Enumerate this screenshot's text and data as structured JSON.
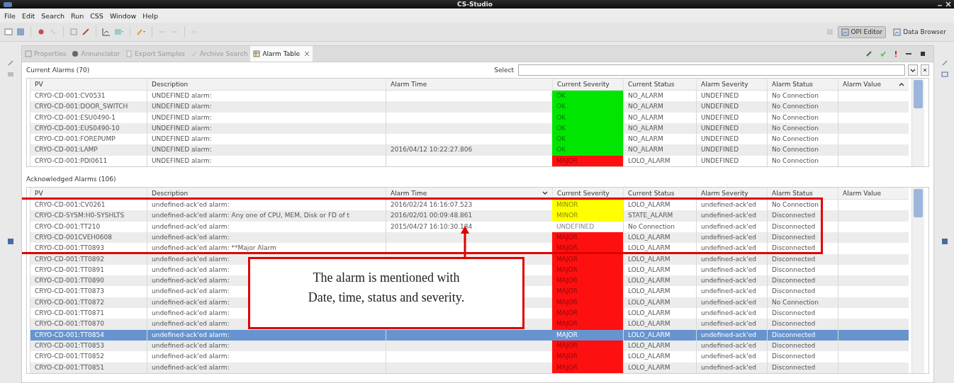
{
  "window": {
    "title": "CS-Studio"
  },
  "menu": [
    "File",
    "Edit",
    "Search",
    "Run",
    "CSS",
    "Window",
    "Help"
  ],
  "perspectives": [
    {
      "label": "OPI Editor",
      "selected": true
    },
    {
      "label": "Data Browser",
      "selected": false
    }
  ],
  "tabs": [
    {
      "label": "Properties",
      "kind": "properties",
      "selected": false
    },
    {
      "label": "Annunciator",
      "kind": "annunciator",
      "selected": false
    },
    {
      "label": "Export Samples",
      "kind": "export",
      "selected": false
    },
    {
      "label": "Archive Search",
      "kind": "archive",
      "selected": false
    },
    {
      "label": "Alarm Table",
      "kind": "table",
      "selected": true
    }
  ],
  "select": {
    "label": "Select"
  },
  "current": {
    "title": "Current Alarms (70)",
    "columns": [
      {
        "label": "PV",
        "sorted": false
      },
      {
        "label": "Description",
        "sorted": false
      },
      {
        "label": "Alarm Time",
        "sorted": false
      },
      {
        "label": "Current Severity",
        "sorted": false
      },
      {
        "label": "Current Status",
        "sorted": false
      },
      {
        "label": "Alarm Severity",
        "sorted": false
      },
      {
        "label": "Alarm Status",
        "sorted": false
      },
      {
        "label": "Alarm Value",
        "sorted": true,
        "descending": false
      }
    ],
    "rows": [
      {
        "pv": "CRYO-CD-001:CV0531",
        "description": "UNDEFINED alarm:",
        "severity": "OK",
        "color": "#00e600",
        "status": "NO_ALARM",
        "alarm_severity": "UNDEFINED",
        "alarm_status": "No Connection",
        "selected": false
      },
      {
        "pv": "CRYO-CD-001:DOOR_SWITCH",
        "description": "UNDEFINED alarm:",
        "severity": "OK",
        "color": "#00e600",
        "status": "NO_ALARM",
        "alarm_severity": "UNDEFINED",
        "alarm_status": "No Connection",
        "selected": false
      },
      {
        "pv": "CRYO-CD-001:ESU0490-1",
        "description": "UNDEFINED alarm:",
        "severity": "OK",
        "color": "#00e600",
        "status": "NO_ALARM",
        "alarm_severity": "UNDEFINED",
        "alarm_status": "No Connection",
        "selected": false
      },
      {
        "pv": "CRYO-CD-001:EUS0490-10",
        "description": "UNDEFINED alarm:",
        "severity": "OK",
        "color": "#00e600",
        "status": "NO_ALARM",
        "alarm_severity": "UNDEFINED",
        "alarm_status": "No Connection",
        "selected": false
      },
      {
        "pv": "CRYO-CD-001:FOREPUMP",
        "description": "UNDEFINED alarm:",
        "severity": "OK",
        "color": "#00e600",
        "status": "NO_ALARM",
        "alarm_severity": "UNDEFINED",
        "alarm_status": "No Connection",
        "selected": false
      },
      {
        "pv": "CRYO-CD-001:LAMP",
        "description": "UNDEFINED alarm:",
        "alarm_time": "2016/04/12 10:22:27.806",
        "severity": "OK",
        "color": "#00e600",
        "status": "NO_ALARM",
        "alarm_severity": "UNDEFINED",
        "alarm_status": "No Connection",
        "selected": false
      },
      {
        "pv": "CRYO-CD-001:PDI0611",
        "description": "UNDEFINED alarm:",
        "severity": "MAJOR",
        "color": "#ff1010",
        "status": "LOLO_ALARM",
        "alarm_severity": "UNDEFINED",
        "alarm_status": "No Connection",
        "selected": false
      }
    ]
  },
  "acknowledged": {
    "title": "Acknowledged Alarms (106)",
    "columns": [
      {
        "label": "PV",
        "sorted": false
      },
      {
        "label": "Description",
        "sorted": false
      },
      {
        "label": "Alarm Time",
        "sorted": true,
        "descending": true
      },
      {
        "label": "Current Severity",
        "sorted": false
      },
      {
        "label": "Current Status",
        "sorted": false
      },
      {
        "label": "Alarm Severity",
        "sorted": false
      },
      {
        "label": "Alarm Status",
        "sorted": false
      },
      {
        "label": "Alarm Value",
        "sorted": false
      }
    ],
    "rows": [
      {
        "pv": "CRYO-CD-001:CV0261",
        "description": "undefined-ack'ed alarm:",
        "alarm_time": "2016/02/24 16:16:07.523",
        "severity": "MINOR",
        "color": "#ffff00",
        "status": "LOLO_ALARM",
        "alarm_severity": "undefined-ack'ed",
        "alarm_status": "No Connection",
        "selected": false
      },
      {
        "pv": "CRYO-CD-SYSM:H0-SYSHLTS",
        "description": "undefined-ack'ed alarm: Any one of CPU, MEM, Disk or FD of t",
        "alarm_time": "2016/02/01 00:09:48.861",
        "severity": "MINOR",
        "color": "#ffff00",
        "status": "STATE_ALARM",
        "alarm_severity": "undefined-ack'ed",
        "alarm_status": "Disconnected",
        "selected": false
      },
      {
        "pv": "CRYO-CD-001:TT210",
        "description": "undefined-ack'ed alarm:",
        "alarm_time": "2015/04/27 16:10:30.184",
        "severity": "UNDEFINED",
        "color": "#ffffff",
        "status": "No Connection",
        "alarm_severity": "undefined-ack'ed",
        "alarm_status": "Disconnected",
        "selected": false
      },
      {
        "pv": "CRYO-CD-001CVEH0608",
        "description": "undefined-ack'ed alarm:",
        "severity": "MAJOR",
        "color": "#ff1010",
        "status": "LOLO_ALARM",
        "alarm_severity": "undefined-ack'ed",
        "alarm_status": "Disconnected",
        "selected": false
      },
      {
        "pv": "CRYO-CD-001:TT0893",
        "description": "undefined-ack'ed alarm: **Major Alarm",
        "severity": "MAJOR",
        "color": "#ff1010",
        "status": "LOLO_ALARM",
        "alarm_severity": "undefined-ack'ed",
        "alarm_status": "Disconnected",
        "selected": false
      },
      {
        "pv": "CRYO-CD-001:TT0892",
        "description": "undefined-ack'ed alarm:",
        "severity": "MAJOR",
        "color": "#ff1010",
        "status": "LOLO_ALARM",
        "alarm_severity": "undefined-ack'ed",
        "alarm_status": "Disconnected",
        "selected": false
      },
      {
        "pv": "CRYO-CD-001:TT0891",
        "description": "undefined-ack'ed alarm:",
        "severity": "MAJOR",
        "color": "#ff1010",
        "status": "LOLO_ALARM",
        "alarm_severity": "undefined-ack'ed",
        "alarm_status": "Disconnected",
        "selected": false
      },
      {
        "pv": "CRYO-CD-001:TT0890",
        "description": "undefined-ack'ed alarm:",
        "severity": "MAJOR",
        "color": "#ff1010",
        "status": "LOLO_ALARM",
        "alarm_severity": "undefined-ack'ed",
        "alarm_status": "Disconnected",
        "selected": false
      },
      {
        "pv": "CRYO-CD-001:TT0873",
        "description": "undefined-ack'ed alarm:",
        "severity": "MAJOR",
        "color": "#ff1010",
        "status": "LOLO_ALARM",
        "alarm_severity": "undefined-ack'ed",
        "alarm_status": "Disconnected",
        "selected": false
      },
      {
        "pv": "CRYO-CD-001:TT0872",
        "description": "undefined-ack'ed alarm:",
        "severity": "MAJOR",
        "color": "#ff1010",
        "status": "LOLO_ALARM",
        "alarm_severity": "undefined-ack'ed",
        "alarm_status": "No Connection",
        "selected": false
      },
      {
        "pv": "CRYO-CD-001:TT0871",
        "description": "undefined-ack'ed alarm:",
        "severity": "MAJOR",
        "color": "#ff1010",
        "status": "LOLO_ALARM",
        "alarm_severity": "undefined-ack'ed",
        "alarm_status": "Disconnected",
        "selected": false
      },
      {
        "pv": "CRYO-CD-001:TT0870",
        "description": "undefined-ack'ed alarm:",
        "severity": "MAJOR",
        "color": "#ff1010",
        "status": "LOLO_ALARM",
        "alarm_severity": "undefined-ack'ed",
        "alarm_status": "Disconnected",
        "selected": false
      },
      {
        "pv": "CRYO-CD-001:TT0854",
        "description": "undefined-ack'ed alarm:",
        "severity": "MAJOR",
        "status": "LOLO_ALARM",
        "alarm_severity": "undefined-ack'ed",
        "alarm_status": "Disconnected",
        "selected": true
      },
      {
        "pv": "CRYO-CD-001:TT0853",
        "description": "undefined-ack'ed alarm:",
        "severity": "MAJOR",
        "color": "#ff1010",
        "status": "LOLO_ALARM",
        "alarm_severity": "undefined-ack'ed",
        "alarm_status": "Disconnected",
        "selected": false
      },
      {
        "pv": "CRYO-CD-001:TT0852",
        "description": "undefined-ack'ed alarm:",
        "severity": "MAJOR",
        "color": "#ff1010",
        "status": "LOLO_ALARM",
        "alarm_severity": "undefined-ack'ed",
        "alarm_status": "Disconnected",
        "selected": false
      },
      {
        "pv": "CRYO-CD-001:TT0851",
        "description": "undefined-ack'ed alarm:",
        "severity": "MAJOR",
        "color": "#ff1010",
        "status": "LOLO_ALARM",
        "alarm_severity": "undefined-ack'ed",
        "alarm_status": "Disconnected",
        "selected": false
      }
    ]
  },
  "callout": {
    "lines": [
      "The alarm is mentioned with",
      "Date, time, status and severity."
    ]
  }
}
